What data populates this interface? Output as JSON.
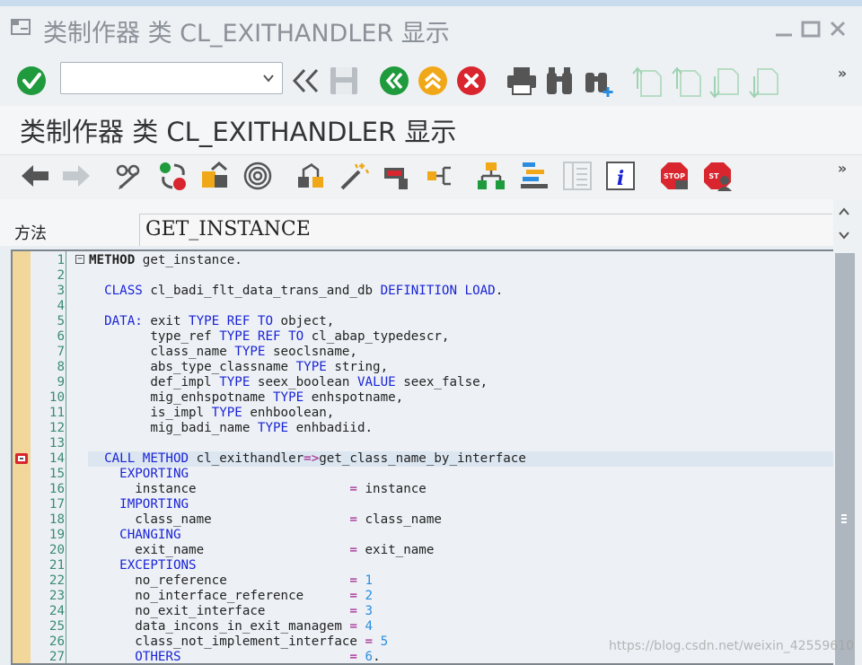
{
  "window": {
    "title": "类制作器 类 CL_EXITHANDLER 显示"
  },
  "toolbar1": {
    "command_value": "",
    "icons": [
      "enter-icon",
      "back-icon",
      "save-icon",
      "exit-icon",
      "up-icon",
      "cancel-icon",
      "print-icon",
      "find-icon",
      "find-next-icon",
      "first-page-icon",
      "prev-page-icon",
      "next-page-icon",
      "last-page-icon"
    ],
    "more": "»"
  },
  "header": {
    "title": "类制作器 类 CL_EXITHANDLER 显示"
  },
  "toolbar2": {
    "icons": [
      "arrow-left-icon",
      "arrow-right-icon",
      "glasses-pencil-icon",
      "activate-icon",
      "object-list-icon",
      "where-used-icon",
      "hierarchy-icon",
      "wand-icon",
      "stamp-icon",
      "branch-icon",
      "tree-icon",
      "pretty-printer-icon",
      "layout-icon",
      "info-icon",
      "stop-icon",
      "stop-user-icon"
    ],
    "more": "»"
  },
  "method": {
    "label": "方法",
    "value": "GET_INSTANCE"
  },
  "editor": {
    "lines": [
      {
        "no": "1",
        "segments": [
          {
            "t": "METHOD",
            "c": "b"
          },
          {
            "t": " get_instance.",
            "c": ""
          }
        ]
      },
      {
        "no": "2",
        "segments": []
      },
      {
        "no": "3",
        "segments": [
          {
            "t": "  CLASS",
            "c": "kw"
          },
          {
            "t": " cl_badi_flt_data_trans_and_db ",
            "c": ""
          },
          {
            "t": "DEFINITION LOAD",
            "c": "kw"
          },
          {
            "t": ".",
            "c": ""
          }
        ]
      },
      {
        "no": "4",
        "segments": []
      },
      {
        "no": "5",
        "segments": [
          {
            "t": "  DATA:",
            "c": "kw"
          },
          {
            "t": " exit ",
            "c": ""
          },
          {
            "t": "TYPE REF TO",
            "c": "kw"
          },
          {
            "t": " object,",
            "c": ""
          }
        ]
      },
      {
        "no": "6",
        "segments": [
          {
            "t": "        type_ref ",
            "c": ""
          },
          {
            "t": "TYPE REF TO",
            "c": "kw"
          },
          {
            "t": " cl_abap_typedescr,",
            "c": ""
          }
        ]
      },
      {
        "no": "7",
        "segments": [
          {
            "t": "        class_name ",
            "c": ""
          },
          {
            "t": "TYPE",
            "c": "kw"
          },
          {
            "t": " seoclsname,",
            "c": ""
          }
        ]
      },
      {
        "no": "8",
        "segments": [
          {
            "t": "        abs_type_classname ",
            "c": ""
          },
          {
            "t": "TYPE",
            "c": "kw"
          },
          {
            "t": " string,",
            "c": ""
          }
        ]
      },
      {
        "no": "9",
        "segments": [
          {
            "t": "        def_impl ",
            "c": ""
          },
          {
            "t": "TYPE",
            "c": "kw"
          },
          {
            "t": " seex_boolean ",
            "c": ""
          },
          {
            "t": "VALUE",
            "c": "kw"
          },
          {
            "t": " seex_false,",
            "c": ""
          }
        ]
      },
      {
        "no": "10",
        "segments": [
          {
            "t": "        mig_enhspotname ",
            "c": ""
          },
          {
            "t": "TYPE",
            "c": "kw"
          },
          {
            "t": " enhspotname,",
            "c": ""
          }
        ]
      },
      {
        "no": "11",
        "segments": [
          {
            "t": "        is_impl ",
            "c": ""
          },
          {
            "t": "TYPE",
            "c": "kw"
          },
          {
            "t": " enhboolean,",
            "c": ""
          }
        ]
      },
      {
        "no": "12",
        "segments": [
          {
            "t": "        mig_badi_name ",
            "c": ""
          },
          {
            "t": "TYPE",
            "c": "kw"
          },
          {
            "t": " enhbadiid.",
            "c": ""
          }
        ]
      },
      {
        "no": "13",
        "segments": []
      },
      {
        "no": "14",
        "segments": [
          {
            "t": "  CALL METHOD",
            "c": "kw"
          },
          {
            "t": " cl_exithandler",
            "c": ""
          },
          {
            "t": "=>",
            "c": "op"
          },
          {
            "t": "get_class_name_by_interface",
            "c": ""
          }
        ]
      },
      {
        "no": "15",
        "segments": [
          {
            "t": "    EXPORTING",
            "c": "kw"
          }
        ]
      },
      {
        "no": "16",
        "segments": [
          {
            "t": "      instance                    ",
            "c": ""
          },
          {
            "t": "=",
            "c": "op"
          },
          {
            "t": " instance",
            "c": ""
          }
        ]
      },
      {
        "no": "17",
        "segments": [
          {
            "t": "    IMPORTING",
            "c": "kw"
          }
        ]
      },
      {
        "no": "18",
        "segments": [
          {
            "t": "      class_name                  ",
            "c": ""
          },
          {
            "t": "=",
            "c": "op"
          },
          {
            "t": " class_name",
            "c": ""
          }
        ]
      },
      {
        "no": "19",
        "segments": [
          {
            "t": "    CHANGING",
            "c": "kw"
          }
        ]
      },
      {
        "no": "20",
        "segments": [
          {
            "t": "      exit_name                   ",
            "c": ""
          },
          {
            "t": "=",
            "c": "op"
          },
          {
            "t": " exit_name",
            "c": ""
          }
        ]
      },
      {
        "no": "21",
        "segments": [
          {
            "t": "    EXCEPTIONS",
            "c": "kw"
          }
        ]
      },
      {
        "no": "22",
        "segments": [
          {
            "t": "      no_reference                ",
            "c": ""
          },
          {
            "t": "=",
            "c": "op"
          },
          {
            "t": " 1",
            "c": "num"
          }
        ]
      },
      {
        "no": "23",
        "segments": [
          {
            "t": "      no_interface_reference      ",
            "c": ""
          },
          {
            "t": "=",
            "c": "op"
          },
          {
            "t": " 2",
            "c": "num"
          }
        ]
      },
      {
        "no": "24",
        "segments": [
          {
            "t": "      no_exit_interface           ",
            "c": ""
          },
          {
            "t": "=",
            "c": "op"
          },
          {
            "t": " 3",
            "c": "num"
          }
        ]
      },
      {
        "no": "25",
        "segments": [
          {
            "t": "      data_incons_in_exit_managem ",
            "c": ""
          },
          {
            "t": "=",
            "c": "op"
          },
          {
            "t": " 4",
            "c": "num"
          }
        ]
      },
      {
        "no": "26",
        "segments": [
          {
            "t": "      class_not_implement_interface ",
            "c": ""
          },
          {
            "t": "=",
            "c": "op"
          },
          {
            "t": " 5",
            "c": "num"
          }
        ]
      },
      {
        "no": "27",
        "segments": [
          {
            "t": "      OTHERS",
            "c": "kw"
          },
          {
            "t": "                      ",
            "c": ""
          },
          {
            "t": "=",
            "c": "op"
          },
          {
            "t": " 6",
            "c": "num"
          },
          {
            "t": ".",
            "c": ""
          }
        ]
      }
    ],
    "breakpoint_line": "14",
    "highlight_line": "14"
  },
  "watermark": "https://blog.csdn.net/weixin_42559610",
  "colors": {
    "keyword": "#1a23d6",
    "operator": "#a0208c",
    "number": "#2a8de0",
    "line_number": "#3a8a78"
  }
}
